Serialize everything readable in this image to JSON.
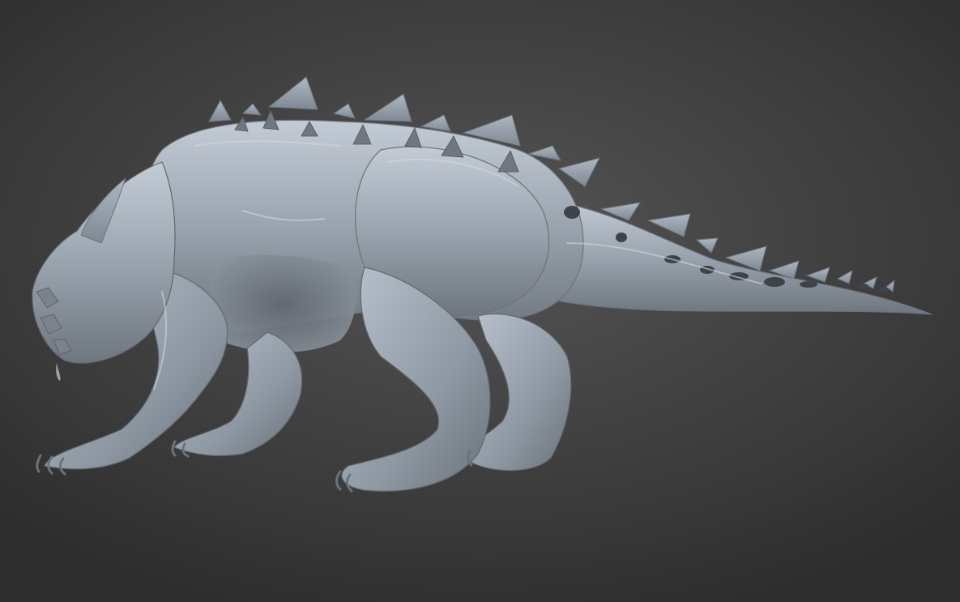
{
  "viewport": {
    "background_top": "#555555",
    "background_bottom": "#2e2e2e",
    "model_color": "#8f9aa6",
    "model_highlight": "#c4ccd6",
    "model_shadow": "#4a5058"
  },
  "model": {
    "subject": "creature-sculpt-icon"
  }
}
